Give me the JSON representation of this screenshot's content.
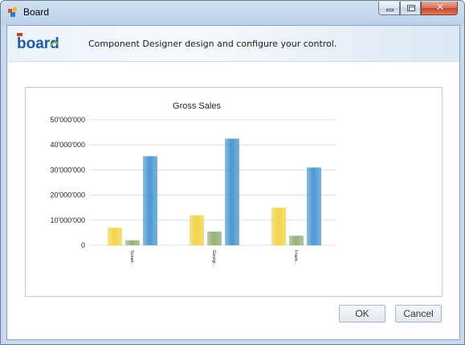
{
  "window": {
    "title": "Board"
  },
  "header": {
    "logo_text": "board",
    "description": "Component Designer design and configure your control."
  },
  "buttons": {
    "ok": "OK",
    "cancel": "Cancel"
  },
  "colors": {
    "series_yellow": "#f0d44a",
    "series_green": "#98b07a",
    "series_blue": "#4e98d0",
    "logo_blue": "#1f5aa6"
  },
  "chart_data": {
    "type": "bar",
    "title": "Gross Sales",
    "categories": [
      "Susan...",
      "Georgi...",
      "Frank..."
    ],
    "series": [
      {
        "values": [
          7000000,
          12000000,
          15000000
        ],
        "color": "#f0d44a"
      },
      {
        "values": [
          2000000,
          5500000,
          3800000
        ],
        "color": "#98b07a"
      },
      {
        "values": [
          35500000,
          42500000,
          31000000
        ],
        "color": "#4e98d0"
      }
    ],
    "ylim": [
      0,
      50000000
    ],
    "y_ticks": [
      "0",
      "10'000'000",
      "20'000'000",
      "30'000'000",
      "40'000'000",
      "50'000'000"
    ],
    "grid": true,
    "xlabel": "",
    "ylabel": ""
  }
}
